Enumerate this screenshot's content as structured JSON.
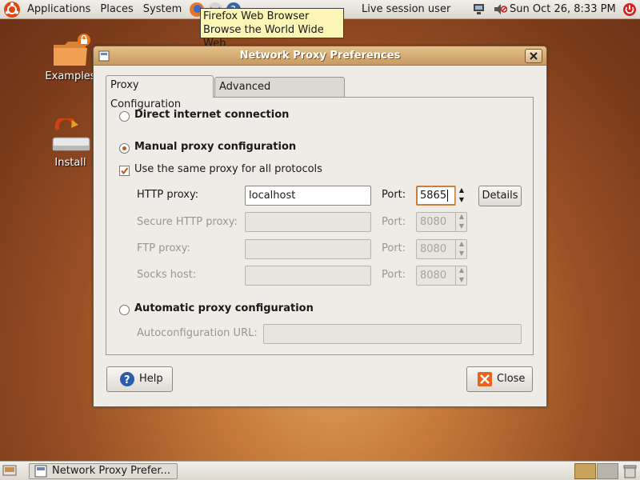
{
  "top_panel": {
    "menus": [
      "Applications",
      "Places",
      "System"
    ],
    "user": "Live session user",
    "clock": "Sun Oct 26,  8:33 PM"
  },
  "tooltip": {
    "line1": "Firefox Web Browser",
    "line2": "Browse the World Wide Web"
  },
  "desktop": {
    "examples_label": "Examples",
    "install_label": "Install"
  },
  "window": {
    "title": "Network Proxy Preferences",
    "tabs": [
      "Proxy Configuration",
      "Advanced Configuration"
    ],
    "direct_label": "Direct internet connection",
    "manual_label": "Manual proxy configuration",
    "same_proxy_label": "Use the same proxy for all protocols",
    "http_label": "HTTP proxy:",
    "http_value": "localhost",
    "port_label": "Port:",
    "http_port": "5865",
    "details_label": "Details",
    "secure_label": "Secure HTTP proxy:",
    "secure_port": "8080",
    "ftp_label": "FTP proxy:",
    "ftp_port": "8080",
    "socks_label": "Socks host:",
    "socks_port": "8080",
    "auto_label": "Automatic proxy configuration",
    "autoconf_label": "Autoconfiguration URL:",
    "help_label": "Help",
    "close_label": "Close"
  },
  "taskbar": {
    "task_label": "Network Proxy Prefer..."
  },
  "colors": {
    "accent": "#c7813a",
    "titlebar": "#d4a870"
  }
}
